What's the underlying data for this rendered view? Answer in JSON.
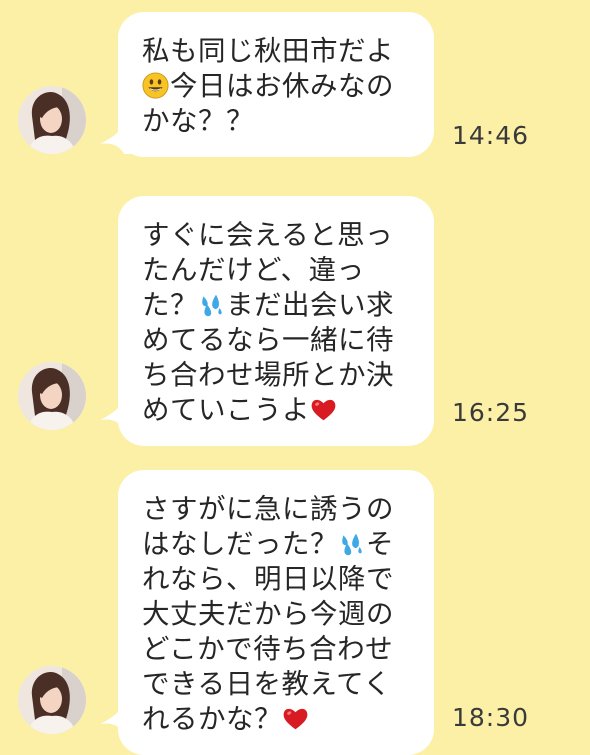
{
  "chat": {
    "messages": [
      {
        "lines": [
          [
            {
              "t": "text",
              "v": "私も同じ秋田市だよ"
            }
          ],
          [
            {
              "t": "emoji",
              "v": "grinning-face-emoji"
            },
            {
              "t": "text",
              "v": "今日はお休みなの"
            }
          ],
          [
            {
              "t": "text",
              "v": "かな？？"
            }
          ]
        ],
        "time": "14:46"
      },
      {
        "lines": [
          [
            {
              "t": "text",
              "v": "すぐに会えると思っ"
            }
          ],
          [
            {
              "t": "text",
              "v": "たんだけど、違っ"
            }
          ],
          [
            {
              "t": "text",
              "v": "た？"
            },
            {
              "t": "emoji",
              "v": "sweat-droplets-emoji"
            },
            {
              "t": "text",
              "v": "まだ出会い求"
            }
          ],
          [
            {
              "t": "text",
              "v": "めてるなら一緒に待"
            }
          ],
          [
            {
              "t": "text",
              "v": "ち合わせ場所とか決"
            }
          ],
          [
            {
              "t": "text",
              "v": "めていこうよ"
            },
            {
              "t": "emoji",
              "v": "red-heart-emoji"
            }
          ]
        ],
        "time": "16:25"
      },
      {
        "lines": [
          [
            {
              "t": "text",
              "v": "さすがに急に誘うの"
            }
          ],
          [
            {
              "t": "text",
              "v": "はなしだった？"
            },
            {
              "t": "emoji",
              "v": "sweat-droplets-emoji"
            },
            {
              "t": "text",
              "v": "そ"
            }
          ],
          [
            {
              "t": "text",
              "v": "れなら、明日以降で"
            }
          ],
          [
            {
              "t": "text",
              "v": "大丈夫だから今週の"
            }
          ],
          [
            {
              "t": "text",
              "v": "どこかで待ち合わせ"
            }
          ],
          [
            {
              "t": "text",
              "v": "できる日を教えてく"
            }
          ],
          [
            {
              "t": "text",
              "v": "れるかな？"
            },
            {
              "t": "emoji",
              "v": "red-heart-emoji"
            }
          ]
        ],
        "time": "18:30"
      }
    ]
  },
  "colors": {
    "background": "#fbf0a6",
    "bubble": "#ffffff",
    "text": "#262626",
    "time": "#3a3a3a",
    "heart": "#d81b22",
    "sweat": "#3fa9e8",
    "smiley": "#f7c325"
  }
}
